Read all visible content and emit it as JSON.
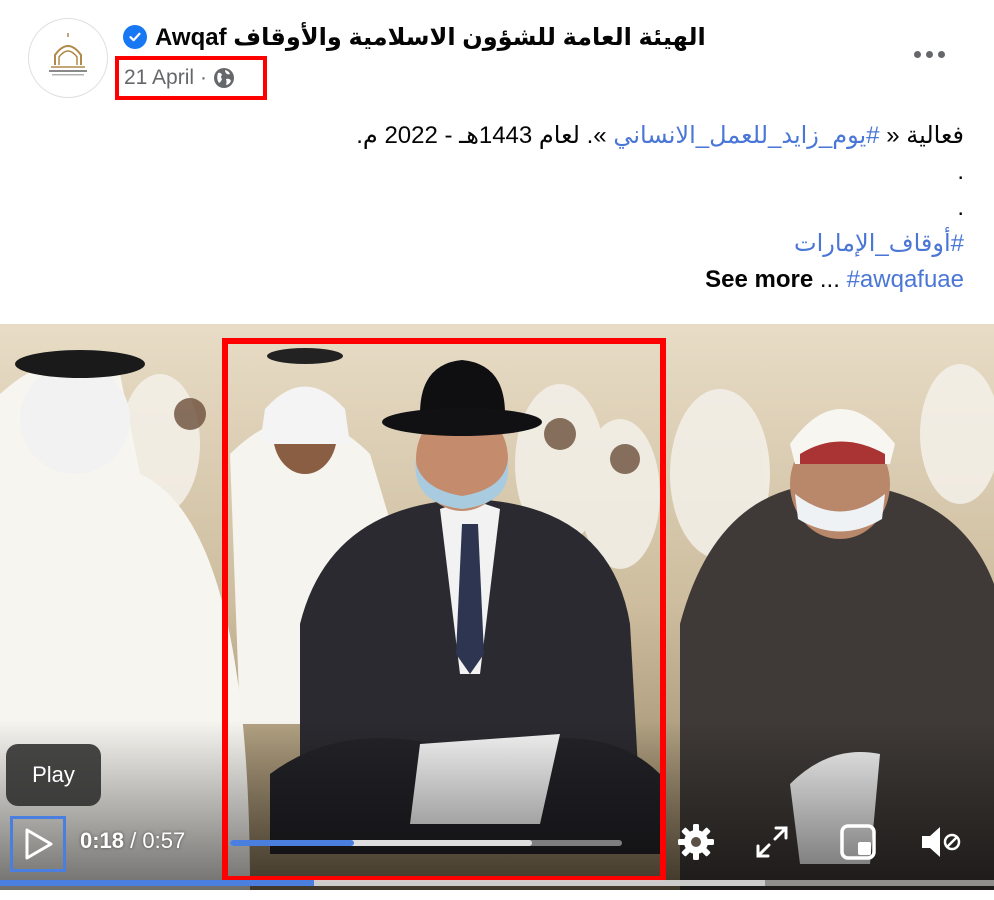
{
  "post": {
    "page_name": "الهيئة العامة للشؤون الاسلامية والأوقاف Awqaf",
    "date": "21 April",
    "separator": "·",
    "audience_icon": "globe-icon",
    "verified_icon": "verified-badge-icon",
    "more_icon": "more-options-icon",
    "text_line1_prefix": "فعالية « ",
    "text_line1_hashtag": "#يوم_زايد_للعمل_الانساني",
    "text_line1_suffix": " ». لعام  1443هـ - 2022 م.",
    "text_line2": ".",
    "text_line3": ".",
    "hashtag_emirates": "#أوقاف_الإمارات",
    "hashtag_awqafuae": "#awqafuae",
    "ellipsis": " ... ",
    "see_more": "See more"
  },
  "video": {
    "tooltip": "Play",
    "current_time": "0:18",
    "separator": " / ",
    "duration": "0:57",
    "progress_fraction": 0.316,
    "buffered_fraction": 0.77,
    "controls": [
      "play-icon",
      "settings-icon",
      "fullscreen-icon",
      "picture-in-picture-icon",
      "mute-icon"
    ]
  },
  "colors": {
    "accent": "#4a7fe0",
    "hashtag": "#4a76d6",
    "highlight": "#ff0000",
    "meta_text": "#65676b"
  }
}
